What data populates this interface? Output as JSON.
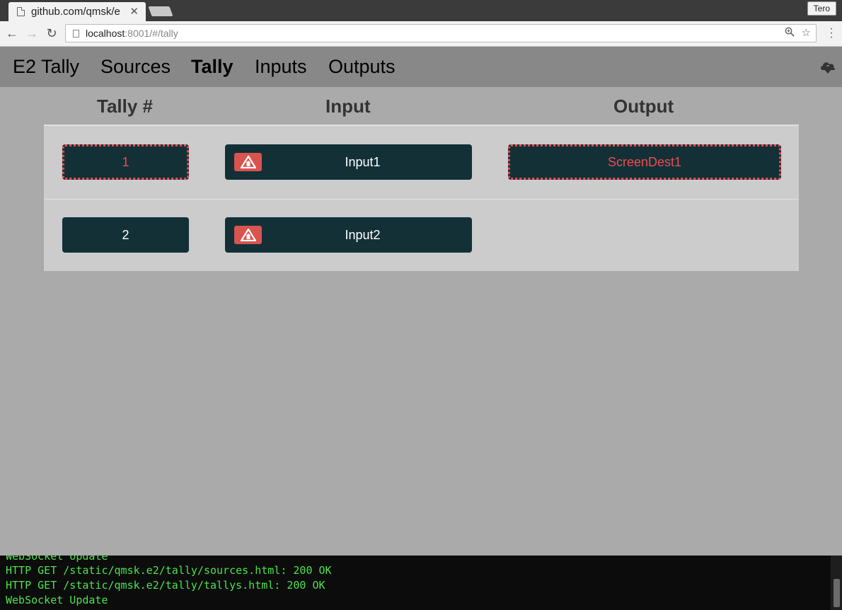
{
  "browser": {
    "tab_title": "github.com/qmsk/e",
    "profile": "Tero",
    "url_host": "localhost",
    "url_rest": ":8001/#/tally"
  },
  "nav": {
    "brand": "E2 Tally",
    "links": [
      "Sources",
      "Tally",
      "Inputs",
      "Outputs"
    ],
    "active": "Tally"
  },
  "table": {
    "columns": [
      "Tally #",
      "Input",
      "Output"
    ],
    "rows": [
      {
        "tally": "1",
        "input": "Input1",
        "output": "ScreenDest1",
        "tally_alert": true,
        "output_alert": true
      },
      {
        "tally": "2",
        "input": "Input2",
        "output": "",
        "tally_alert": false,
        "output_alert": false
      }
    ]
  },
  "terminal": {
    "lines": [
      "WebSocket Update",
      "HTTP GET /static/qmsk.e2/tally/sources.html: 200 OK",
      "HTTP GET /static/qmsk.e2/tally/tallys.html: 200 OK",
      "WebSocket Update"
    ]
  },
  "colors": {
    "alert": "#ef4a50",
    "cell_bg": "#133037",
    "badge": "#d9534f",
    "terminal_text": "#4be34b"
  }
}
